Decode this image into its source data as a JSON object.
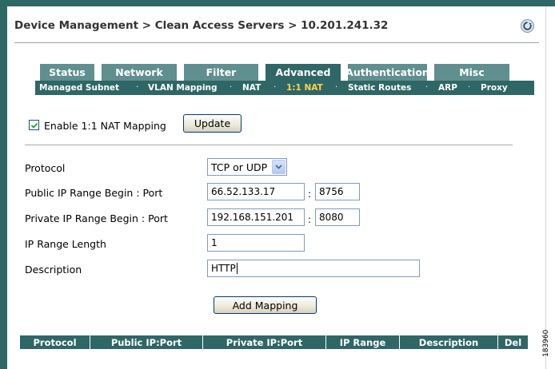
{
  "breadcrumb": "Device Management > Clean Access Servers > 10.201.241.32",
  "tabs": [
    {
      "label": "Status",
      "active": false
    },
    {
      "label": "Network",
      "active": false
    },
    {
      "label": "Filter",
      "active": false
    },
    {
      "label": "Advanced",
      "active": true
    },
    {
      "label": "Authentication",
      "active": false
    },
    {
      "label": "Misc",
      "active": false
    }
  ],
  "subnav": [
    {
      "label": "Managed Subnet",
      "active": false
    },
    {
      "label": "VLAN Mapping",
      "active": false
    },
    {
      "label": "NAT",
      "active": false
    },
    {
      "label": "1:1 NAT",
      "active": true
    },
    {
      "label": "Static Routes",
      "active": false
    },
    {
      "label": "ARP",
      "active": false
    },
    {
      "label": "Proxy",
      "active": false
    }
  ],
  "subnav_separator": "·",
  "enable": {
    "label": "Enable 1:1 NAT Mapping",
    "checked": true
  },
  "update_button": "Update",
  "form": {
    "protocol": {
      "label": "Protocol",
      "value": "TCP or UDP"
    },
    "public": {
      "label": "Public IP Range Begin : Port",
      "ip": "66.52.133.17",
      "port": "8756"
    },
    "private": {
      "label": "Private IP Range Begin : Port",
      "ip": "192.168.151.201",
      "port": "8080"
    },
    "length": {
      "label": "IP Range Length",
      "value": "1"
    },
    "description": {
      "label": "Description",
      "value": "HTTP"
    },
    "port_separator": ":"
  },
  "add_button": "Add Mapping",
  "table_headers": [
    "Protocol",
    "Public IP:Port",
    "Private IP:Port",
    "IP Range",
    "Description",
    "Del"
  ],
  "figure_id": "183960",
  "colors": {
    "band": "#2f6666",
    "tab": "#5f8f8f",
    "active_subnav": "#ffd24a"
  }
}
